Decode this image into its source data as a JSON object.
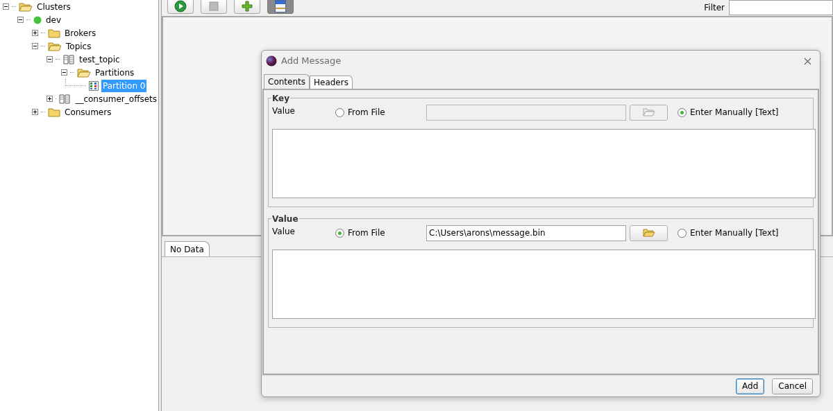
{
  "tree": [
    {
      "label": "Clusters",
      "kind": "folder",
      "expanded": true,
      "selected": false,
      "children": [
        {
          "label": "dev",
          "kind": "server",
          "expanded": true,
          "selected": false,
          "children": [
            {
              "label": "Brokers",
              "kind": "folder",
              "expanded": false,
              "selected": false
            },
            {
              "label": "Topics",
              "kind": "folder",
              "expanded": true,
              "selected": false,
              "children": [
                {
                  "label": "test_topic",
                  "kind": "topic",
                  "expanded": true,
                  "selected": false,
                  "children": [
                    {
                      "label": "Partitions",
                      "kind": "folder",
                      "expanded": true,
                      "selected": false,
                      "children": [
                        {
                          "label": "Partition 0",
                          "kind": "partition",
                          "selected": true
                        }
                      ]
                    }
                  ]
                },
                {
                  "label": "__consumer_offsets",
                  "kind": "topic",
                  "expanded": false,
                  "selected": false
                }
              ]
            },
            {
              "label": "Consumers",
              "kind": "folder",
              "expanded": false,
              "selected": false
            }
          ]
        }
      ]
    }
  ],
  "toolbar": [
    {
      "kind": "play",
      "pressed": false
    },
    {
      "kind": "stop",
      "pressed": false
    },
    {
      "kind": "add",
      "pressed": false
    },
    {
      "kind": "window",
      "pressed": true
    }
  ],
  "filter": {
    "label": "Filter"
  },
  "bottom_tab": {
    "label": "No Data"
  },
  "dialog": {
    "title": "Add Message",
    "tabs": [
      {
        "label": "Contents",
        "selected": true
      },
      {
        "label": "Headers",
        "selected": false
      }
    ],
    "groups": [
      {
        "title": "Key",
        "label": "Value",
        "from_file": {
          "label": "From File",
          "selected": false
        },
        "manual": {
          "label": "Enter Manually [Text]",
          "selected": true
        }
      },
      {
        "title": "Value",
        "label": "Value",
        "from_file": {
          "label": "From File",
          "selected": true
        },
        "path": "C:\\Users\\arons\\message.bin",
        "manual": {
          "label": "Enter Manually [Text]",
          "selected": false
        }
      }
    ],
    "buttons": [
      {
        "label": "Add",
        "default": true
      },
      {
        "label": "Cancel",
        "default": false
      }
    ]
  }
}
